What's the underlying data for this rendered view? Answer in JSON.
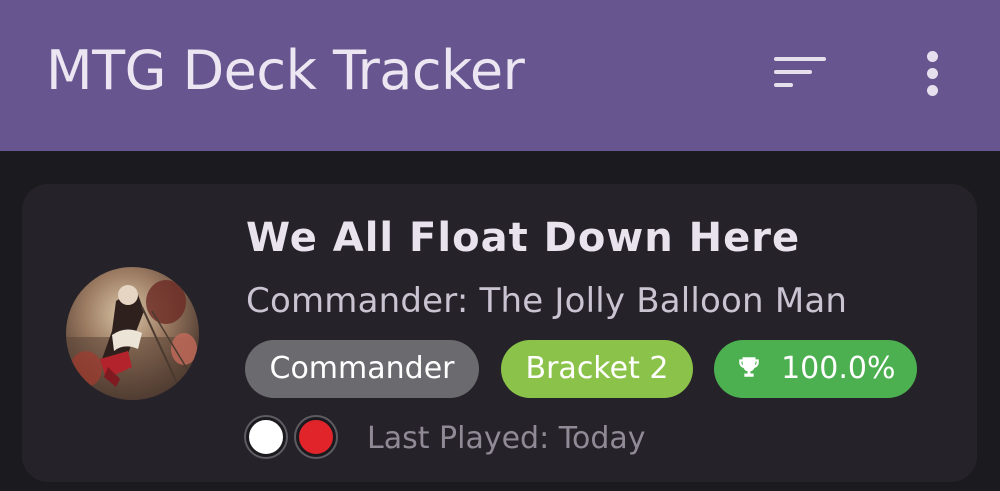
{
  "app_bar": {
    "title": "MTG Deck Tracker",
    "background": "#67558f",
    "actions": [
      {
        "name": "sort",
        "icon": "sort-icon"
      },
      {
        "name": "more",
        "icon": "more-vert-icon"
      }
    ]
  },
  "deck": {
    "name": "We All Float Down Here",
    "commander_line": "Commander: The Jolly Balloon Man",
    "avatar_icon": "commander-art",
    "chips": {
      "format": "Commander",
      "bracket": "Bracket 2",
      "win_rate": "100.0%"
    },
    "chip_colors": {
      "format": "#6b6a6e",
      "bracket": "#8bc34a",
      "win_rate": "#4caf50"
    },
    "color_identity": [
      {
        "color": "white",
        "hex": "#ffffff"
      },
      {
        "color": "red",
        "hex": "#e0242a"
      }
    ],
    "last_played": "Last Played: Today"
  }
}
